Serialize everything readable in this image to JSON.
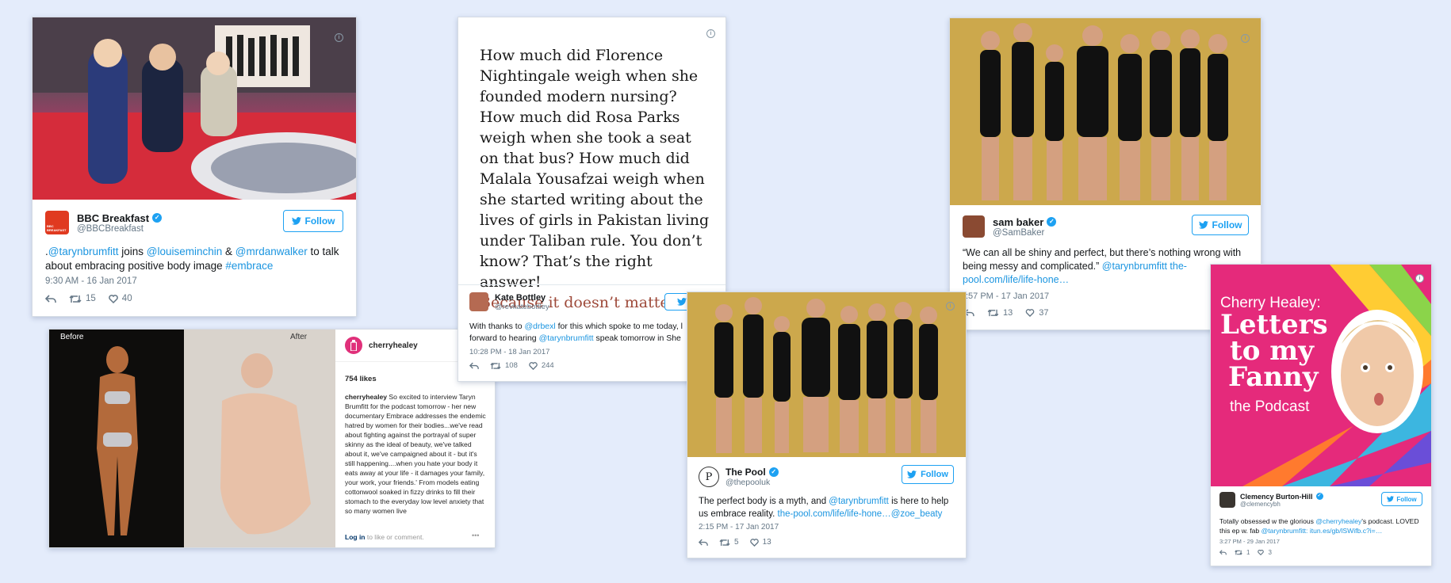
{
  "cards": {
    "bbc": {
      "name": "BBC Breakfast",
      "handle": "@BBCBreakfast",
      "follow": "Follow",
      "text_pre": ".",
      "m1": "@tarynbrumfitt",
      "t1": " joins ",
      "m2": "@louiseminchin",
      "t2": " & ",
      "m3": "@mrdanwalker",
      "t3": " to talk about embracing positive body image ",
      "tag": "#embrace",
      "time": "9:30 AM - 16 Jan 2017",
      "retweets": "15",
      "likes": "40",
      "logo_text": "BBC BREAKFAST"
    },
    "kate": {
      "quote": "How much did Florence Nightingale weigh when she founded modern nursing? How much did Rosa Parks weigh when she took a seat on that bus? How much did Malala Yousafzai weigh when she started writing about the lives of girls in Pakistan living under Taliban rule. You don’t know? That’s the right answer!",
      "quote_emph": "Because it doesn’t matter.",
      "name": "Kate Bottley",
      "handle": "@revkatebottley",
      "follow": "Fo",
      "t1": "With thanks to ",
      "m1": "@drbexl",
      "t2": " for this which spoke to me today, l",
      "t3": "forward to hearing ",
      "m2": "@tarynbrumfitt",
      "t4": " speak tomorrow in She",
      "time": "10:28 PM - 18 Jan 2017",
      "retweets": "108",
      "likes": "244"
    },
    "sam": {
      "name": "sam baker",
      "handle": "@SamBaker",
      "follow": "Follow",
      "t1": "“We can all be shiny and perfect, but there’s nothing wrong with being messy and complicated.” ",
      "m1": "@tarynbrumfitt",
      "link": " the-pool.com/life/life-hone…",
      "time": ":57 PM - 17 Jan 2017",
      "retweets": "13",
      "likes": "37"
    },
    "insta": {
      "before": "Before",
      "after": "After",
      "user": "cherryhealey",
      "follow": "F",
      "likes": "754 likes",
      "caption_user": "cherryhealey",
      "caption": " So excited to interview Taryn Brumfitt for the podcast tomorrow - her new documentary Embrace addresses the endemic hatred by women for their bodies...we've read about fighting against the portrayal of super skinny as the ideal of beauty, we've talked about it, we've campaigned about it - but it's still happening....when you hate your body it eats away at your life - it damages your family, your work, your friends.' From models eating cottonwool soaked in fizzy drinks to fill their stomach to the everyday low level anxiety that so many women live",
      "login": "Log in",
      "login_rest": " to like or comment.",
      "more": "•••"
    },
    "pool": {
      "name": "The Pool",
      "handle": "@thepooluk",
      "follow": "Follow",
      "t1": "The perfect body is a myth, and ",
      "m1": "@tarynbrumfitt",
      "t2": " is here to help us embrace reality. ",
      "link": "the-pool.com/life/life-hone…",
      "m2": "@zoe_beaty",
      "time": "2:15 PM - 17 Jan 2017",
      "retweets": "5",
      "likes": "13"
    },
    "clem": {
      "title1": "Cherry Healey:",
      "title2": "Letters",
      "title3": "to my",
      "title4": "Fanny",
      "title5": "the Podcast",
      "name": "Clemency Burton-Hill",
      "handle": "@clemencybh",
      "follow": "Follow",
      "t1": "Totally obsessed w the glorious ",
      "m1": "@cherryhealey",
      "t2": "'s podcast. LOVED this ep w. fab ",
      "m2": "@tarynbrumfitt",
      "link": ": itun.es/gb/lSWifb.c?i=…",
      "time": "3:27 PM - 29 Jan 2017",
      "retweets": "1",
      "likes": "3"
    }
  },
  "colors": {
    "background": "#e4ecfb",
    "twitter_blue": "#1da1f2",
    "link": "#1b95e0",
    "bbc_red": "#e03a20"
  },
  "icons": [
    "info-icon",
    "verified-icon",
    "twitter-bird-icon",
    "reply-icon",
    "retweet-icon",
    "heart-icon"
  ]
}
